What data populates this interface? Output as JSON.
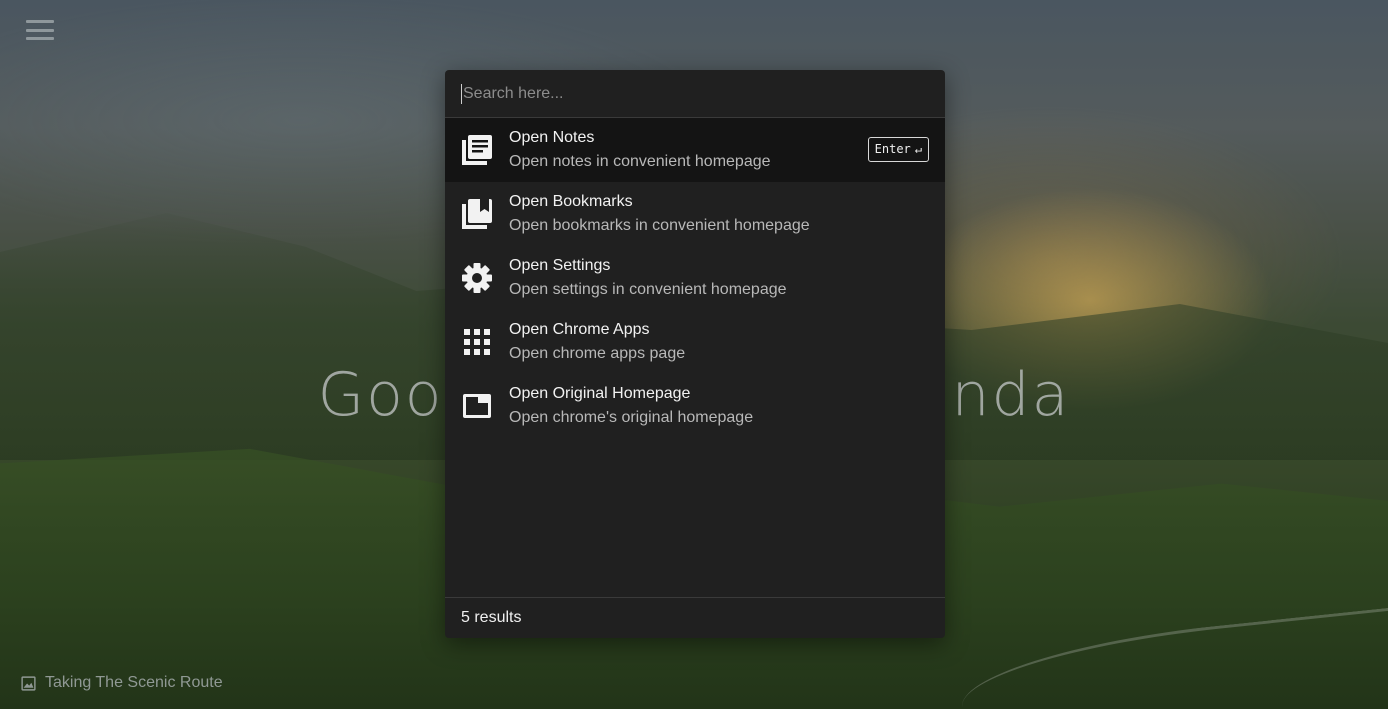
{
  "background": {
    "title": "Goo nda",
    "title_left": "Goo",
    "title_right": "nda",
    "photo_caption": "Taking The Scenic Route"
  },
  "palette": {
    "search_placeholder": "Search here...",
    "search_value": "",
    "items": [
      {
        "title": "Open Notes",
        "description": "Open notes in convenient homepage",
        "icon": "notes-icon",
        "active": true
      },
      {
        "title": "Open Bookmarks",
        "description": "Open bookmarks in convenient homepage",
        "icon": "bookmarks-icon"
      },
      {
        "title": "Open Settings",
        "description": "Open settings in convenient homepage",
        "icon": "gear-icon"
      },
      {
        "title": "Open Chrome Apps",
        "description": "Open chrome apps page",
        "icon": "apps-grid-icon"
      },
      {
        "title": "Open Original Homepage",
        "description": "Open chrome's original homepage",
        "icon": "window-icon"
      }
    ],
    "enter_hint": "Enter",
    "enter_symbol": "↵",
    "result_count": "5 results"
  },
  "colors": {
    "palette_bg": "#202020",
    "active_row_bg": "#141414",
    "text_primary": "#f2f2f2",
    "text_secondary": "#b8b8b8"
  }
}
